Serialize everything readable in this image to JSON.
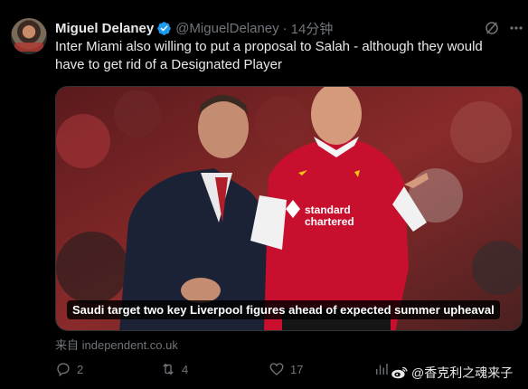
{
  "tweet": {
    "author_name": "Miguel Delaney",
    "author_handle": "@MiguelDelaney",
    "separator": "·",
    "time": "14分钟",
    "text": "Inter Miami also willing to put a proposal to Salah - although they would have to get rid of a Designated Player",
    "media_caption": "Saudi target two key Liverpool figures ahead of expected summer upheaval",
    "source": "来自 independent.co.uk"
  },
  "actions": {
    "replies": "2",
    "reposts": "4",
    "likes": "17"
  },
  "watermark": {
    "text": "@香克利之魂来子"
  },
  "icons": [
    "verified-badge-icon",
    "grok-icon",
    "more-icon",
    "reply-icon",
    "repost-icon",
    "like-icon",
    "views-icon",
    "weibo-icon"
  ],
  "colors": {
    "background": "#000000",
    "primary_text": "#e7e9ea",
    "secondary_text": "#71767b",
    "verified": "#1d9bf0",
    "liverpool_red": "#c8102e"
  }
}
